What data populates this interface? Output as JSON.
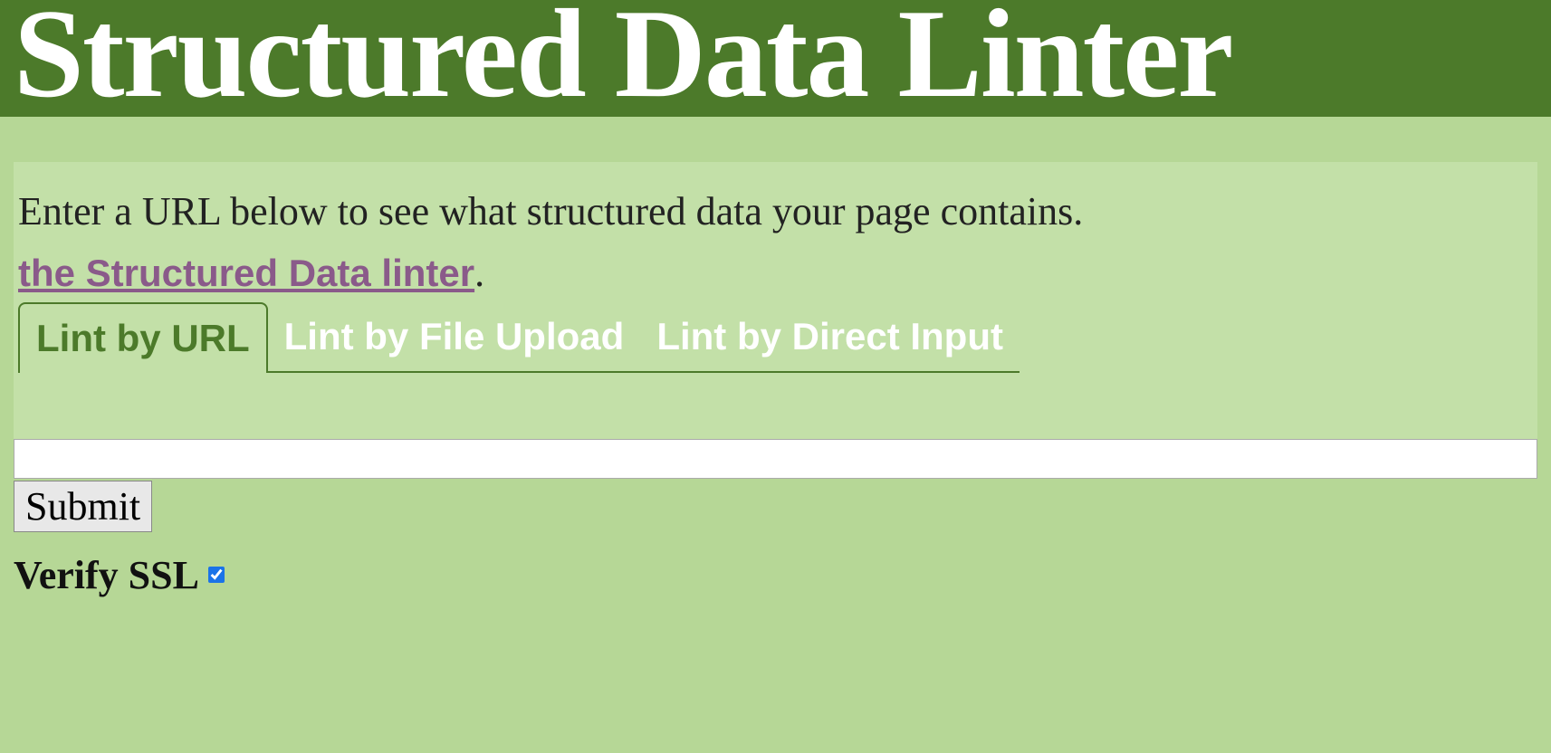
{
  "header": {
    "title": "Structured Data Linter"
  },
  "intro": {
    "text": "Enter a URL below to see what structured data your page contains.",
    "link_text": "the Structured Data linter",
    "period": "."
  },
  "tabs": {
    "items": [
      {
        "label": "Lint by URL",
        "active": true
      },
      {
        "label": "Lint by File Upload",
        "active": false
      },
      {
        "label": "Lint by Direct Input",
        "active": false
      }
    ]
  },
  "form": {
    "url_value": "",
    "submit_label": "Submit",
    "ssl_label": "Verify SSL",
    "ssl_checked": true
  }
}
